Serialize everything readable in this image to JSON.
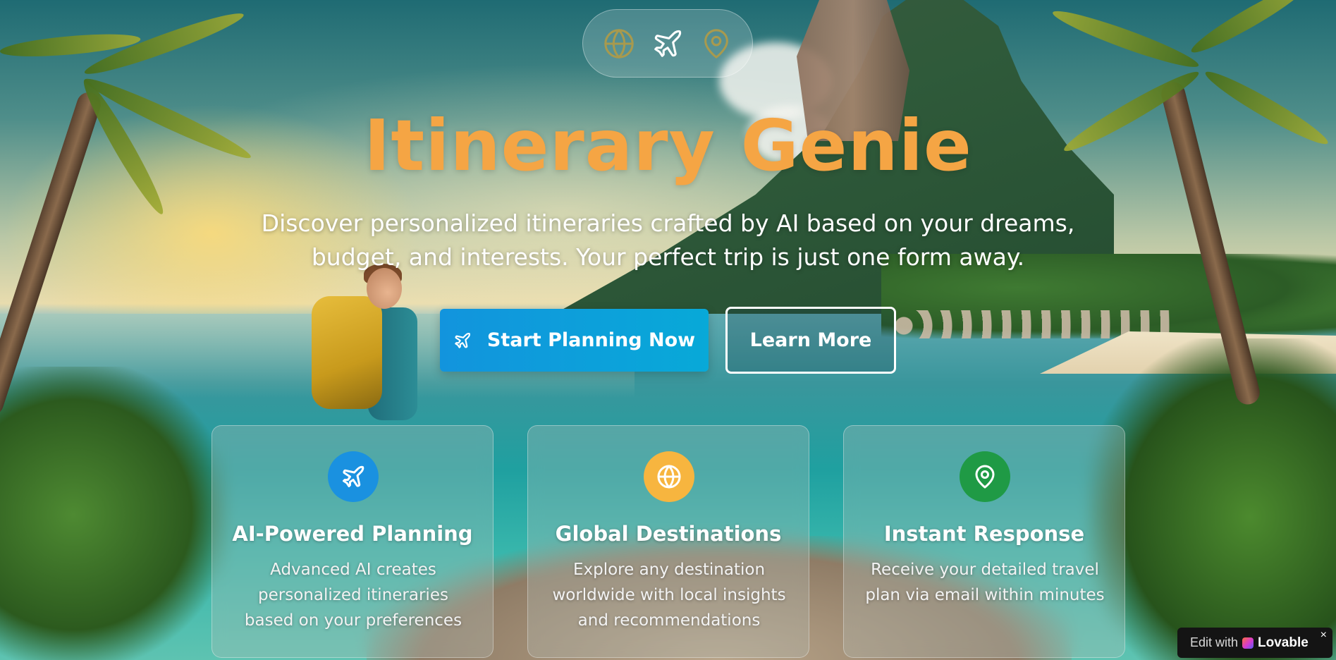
{
  "header": {
    "icons": [
      {
        "name": "globe-icon",
        "color": "#a89a4e"
      },
      {
        "name": "plane-icon",
        "color": "#ffffff"
      },
      {
        "name": "map-pin-icon",
        "color": "#a89a4e"
      }
    ]
  },
  "hero": {
    "title": "Itinerary Genie",
    "subtitle": "Discover personalized itineraries crafted by AI based on your dreams, budget, and interests. Your perfect trip is just one form away.",
    "title_color": "#f5a544"
  },
  "actions": {
    "primary_label": "Start Planning Now",
    "primary_icon": "plane-icon",
    "secondary_label": "Learn More"
  },
  "features": [
    {
      "icon": "plane-icon",
      "badge_color": "#1a91e0",
      "title": "AI-Powered Planning",
      "description": "Advanced AI creates personalized itineraries based on your preferences"
    },
    {
      "icon": "globe-icon",
      "badge_color": "#f7b53f",
      "title": "Global Destinations",
      "description": "Explore any destination worldwide with local insights and recommendations"
    },
    {
      "icon": "map-pin-icon",
      "badge_color": "#1f9a45",
      "title": "Instant Response",
      "description": "Receive your detailed travel plan via email within minutes"
    }
  ],
  "badge": {
    "edit_text": "Edit with",
    "brand": "Lovable",
    "close": "×"
  }
}
